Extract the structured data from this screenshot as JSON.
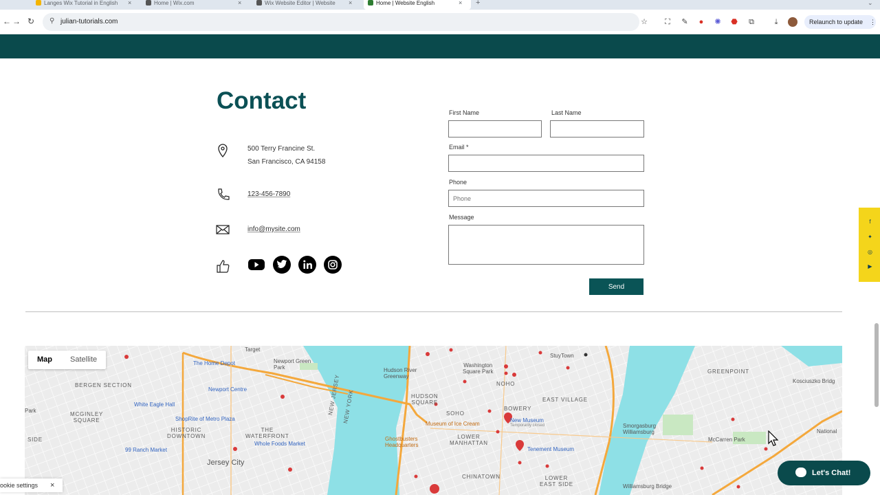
{
  "browser": {
    "tabs": [
      {
        "title": "Langes Wix Tutorial in English",
        "active": false
      },
      {
        "title": "Home | Wix.com",
        "active": false
      },
      {
        "title": "Wix Website Editor | Website",
        "active": false
      },
      {
        "title": "Home | Website English",
        "active": true
      }
    ],
    "url": "julian-tutorials.com",
    "relaunch_label": "Relaunch to update"
  },
  "contact": {
    "title": "Contact",
    "address_line1": "500 Terry Francine St.",
    "address_line2": "San Francisco, CA 94158",
    "phone": "123-456-7890",
    "email": "info@mysite.com"
  },
  "form": {
    "first_name_label": "First Name",
    "last_name_label": "Last Name",
    "email_label": "Email *",
    "phone_label": "Phone",
    "phone_placeholder": "Phone",
    "message_label": "Message",
    "send_label": "Send"
  },
  "map": {
    "tabs": [
      "Map",
      "Satellite"
    ],
    "selected_tab": "Map",
    "labels": {
      "target": "Target",
      "home_depot": "The Home Depot",
      "newport_green_park": "Newport Green Park",
      "bergen_section": "BERGEN SECTION",
      "newport_centre": "Newport Centre",
      "white_eagle_hall": "White Eagle Hall",
      "park": "Park",
      "mcginley_square": "MCGINLEY\nSQUARE",
      "shoprite": "ShopRite of Metro Plaza",
      "historic_downtown": "HISTORIC\nDOWNTOWN",
      "the_waterfront": "THE\nWATERFRONT",
      "whole_foods": "Whole Foods Market",
      "side": "SIDE",
      "ranch_market": "99 Ranch Market",
      "jersey_city": "Jersey City",
      "new_jersey": "NEW JERSEY",
      "new_york": "NEW YORK",
      "hudson_river_greenway": "Hudson River\nGreenway",
      "hudson_square": "HUDSON\nSQUARE",
      "soho": "SOHO",
      "washington_square_park": "Washington\nSquare Park",
      "noho": "NOHO",
      "bowery": "BOWERY",
      "museum_of_ice_cream": "Museum of Ice Cream",
      "new_museum": "New Museum",
      "temporarily_closed": "Temporarily closed",
      "ghostbusters": "Ghostbusters\nHeadquarters",
      "lower_manhattan": "LOWER\nMANHATTAN",
      "tenement_museum": "Tenement Museum",
      "chinatown": "CHINATOWN",
      "lower_east_side": "LOWER\nEAST SIDE",
      "stuytown": "StuyTown",
      "east_village": "EAST VILLAGE",
      "smorgasburg": "Smorgasburg\nWilliamsburg",
      "williamsburg_bridge": "Williamsburg Bridge",
      "greenpoint": "GREENPOINT",
      "kosciuszko_bridge": "Kosciuszko Bridg",
      "mccarren_park": "McCarren Park",
      "national": "National"
    }
  },
  "chat": {
    "label": "Let's Chat!"
  },
  "cookie": {
    "label": "ookie settings",
    "close": "×"
  },
  "colors": {
    "brand_teal": "#0a4a4c",
    "accent_yellow": "#f4d51b",
    "water": "#8ee0e6",
    "highway": "#f4a83c"
  }
}
